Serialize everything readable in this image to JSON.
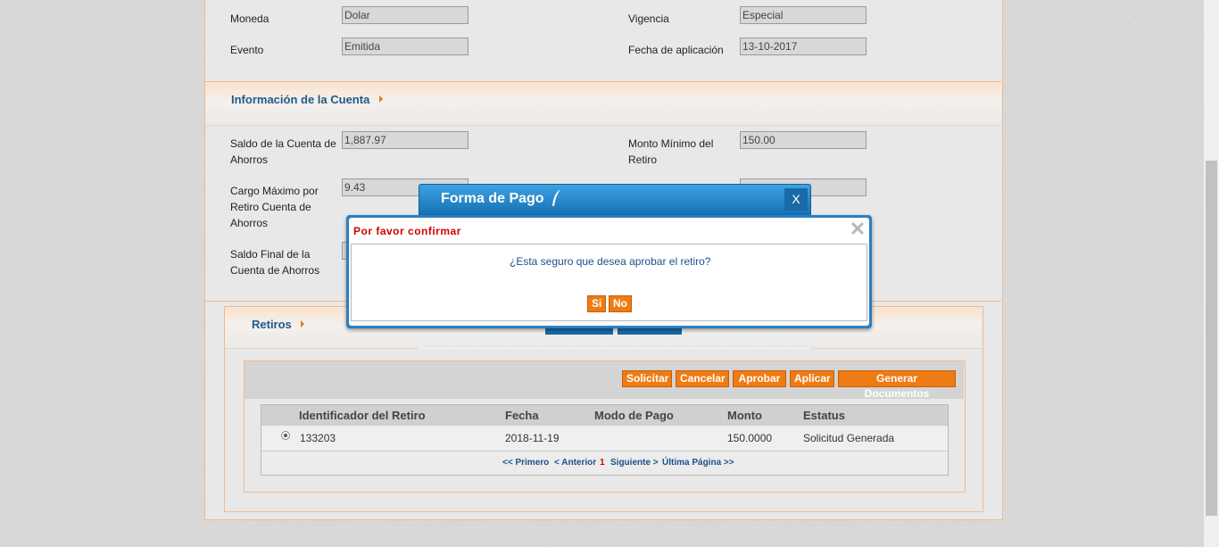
{
  "general": {
    "moneda_label": "Moneda",
    "moneda_value": "Dolar",
    "vigencia_label": "Vigencia",
    "vigencia_value": "Especial",
    "evento_label": "Evento",
    "evento_value": "Emitida",
    "fecha_label": "Fecha de aplicación",
    "fecha_value": "13-10-2017"
  },
  "cuenta": {
    "title": "Información de la Cuenta",
    "saldo_label_1": "Saldo de la Cuenta de",
    "saldo_label_2": "Ahorros",
    "saldo_value": "1,887.97",
    "monto_min_label_1": "Monto Mínimo del",
    "monto_min_label_2": "Retiro",
    "monto_min_value": "150.00",
    "cargo_label_1": "Cargo Máximo por",
    "cargo_label_2": "Retiro Cuenta de",
    "cargo_label_3": "Ahorros",
    "cargo_value": "9.43",
    "saldo_final_label_1": "Saldo Final de la",
    "saldo_final_label_2": "Cuenta de Ahorros"
  },
  "retiros": {
    "title": "Retiros",
    "buttons": {
      "solicitar": "Solicitar",
      "cancelar": "Cancelar",
      "aprobar": "Aprobar",
      "aplicar": "Aplicar",
      "generar": "Generar Documentos"
    },
    "columns": [
      "Identificador del Retiro",
      "Fecha",
      "Modo de Pago",
      "Monto",
      "Estatus"
    ],
    "rows": [
      {
        "id": "133203",
        "fecha": "2018-11-19",
        "modo": "",
        "monto": "150.0000",
        "estatus": "Solicitud Generada"
      }
    ],
    "pager": {
      "first": "<< Primero",
      "prev": "< Anterior",
      "current": "1",
      "next": "Siguiente >",
      "last": "Última Página >>"
    }
  },
  "forma_pago": {
    "title": "Forma de Pago",
    "close": "X"
  },
  "confirm": {
    "title": "Por favor confirmar",
    "message": "¿Esta seguro que desea aprobar el retiro?",
    "yes": "Si",
    "no": "No"
  },
  "colors": {
    "accent": "#ef7b14",
    "link": "#1e5a8a",
    "dialog_blue": "#1c7fc4",
    "confirm_title": "#d40000"
  }
}
